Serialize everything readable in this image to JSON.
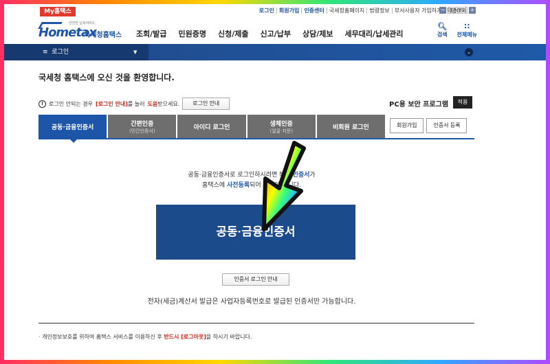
{
  "util": {
    "my_hometax": "My홈택스",
    "links": [
      "로그인",
      "회원가입",
      "인증센터",
      "국세청홈페이지",
      "법령정보",
      "부서사용자 가입하기",
      "화면크기"
    ],
    "zoom_minus": "−",
    "zoom_value": "100%",
    "zoom_plus": "+"
  },
  "header": {
    "logo_small": "안전한 납세서비스",
    "logo_brand": "Hometax",
    "logo_sub": "국세청홈택스",
    "nav": [
      "조회/발급",
      "민원증명",
      "신청/제출",
      "신고/납부",
      "상담/제보",
      "세무대리/납세관리"
    ],
    "search_label": "검색",
    "menu_label": "전체메뉴"
  },
  "navbar": {
    "menu_label": "로그인"
  },
  "welcome": "국세청 홈택스에 오신 것을 환영합니다.",
  "notice": {
    "prefix": "로그인 안되는 경우",
    "red1": "[로그인 안내]",
    "mid": "를 눌러",
    "red2": "도움",
    "suffix": "받으세요.",
    "button": "로그인 안내"
  },
  "pc_security": {
    "label": "PC용 보안 프로그램",
    "button": "적용"
  },
  "tabs": [
    {
      "label": "공동·금융인증서",
      "sub": ""
    },
    {
      "label": "간편인증",
      "sub": "(민간인증서)"
    },
    {
      "label": "아이디 로그인",
      "sub": ""
    },
    {
      "label": "생체인증",
      "sub": "(얼굴·지문)"
    },
    {
      "label": "비회원 로그인",
      "sub": ""
    }
  ],
  "side_buttons": [
    "회원가입",
    "인증서 등록"
  ],
  "desc": {
    "line1_a": "공동·금융인증서로 로그인하시려면 해당",
    "line1_blue": "인증서",
    "line1_b": "가",
    "line2_a": "홈택스에",
    "line2_blue": "사전등록",
    "line2_b": "되어 있어야 합니다."
  },
  "big_button": "공동·금융인증서",
  "cert_guide_button": "인증서 로그인 안내",
  "einvoice_note": "전자(세금)계산서 발급은 사업자등록번호로 발급된 인증서만 가능합니다.",
  "bottom_note": {
    "prefix": "· 개인정보보호를 위하여 홈택스 서비스를 이용하신 후",
    "red": "반드시 [로그아웃]",
    "suffix": "을 하시기 바랍니다."
  },
  "colors": {
    "accent": "#1d55a8",
    "red": "#d4261c",
    "big_button": "#1c4b8c"
  }
}
